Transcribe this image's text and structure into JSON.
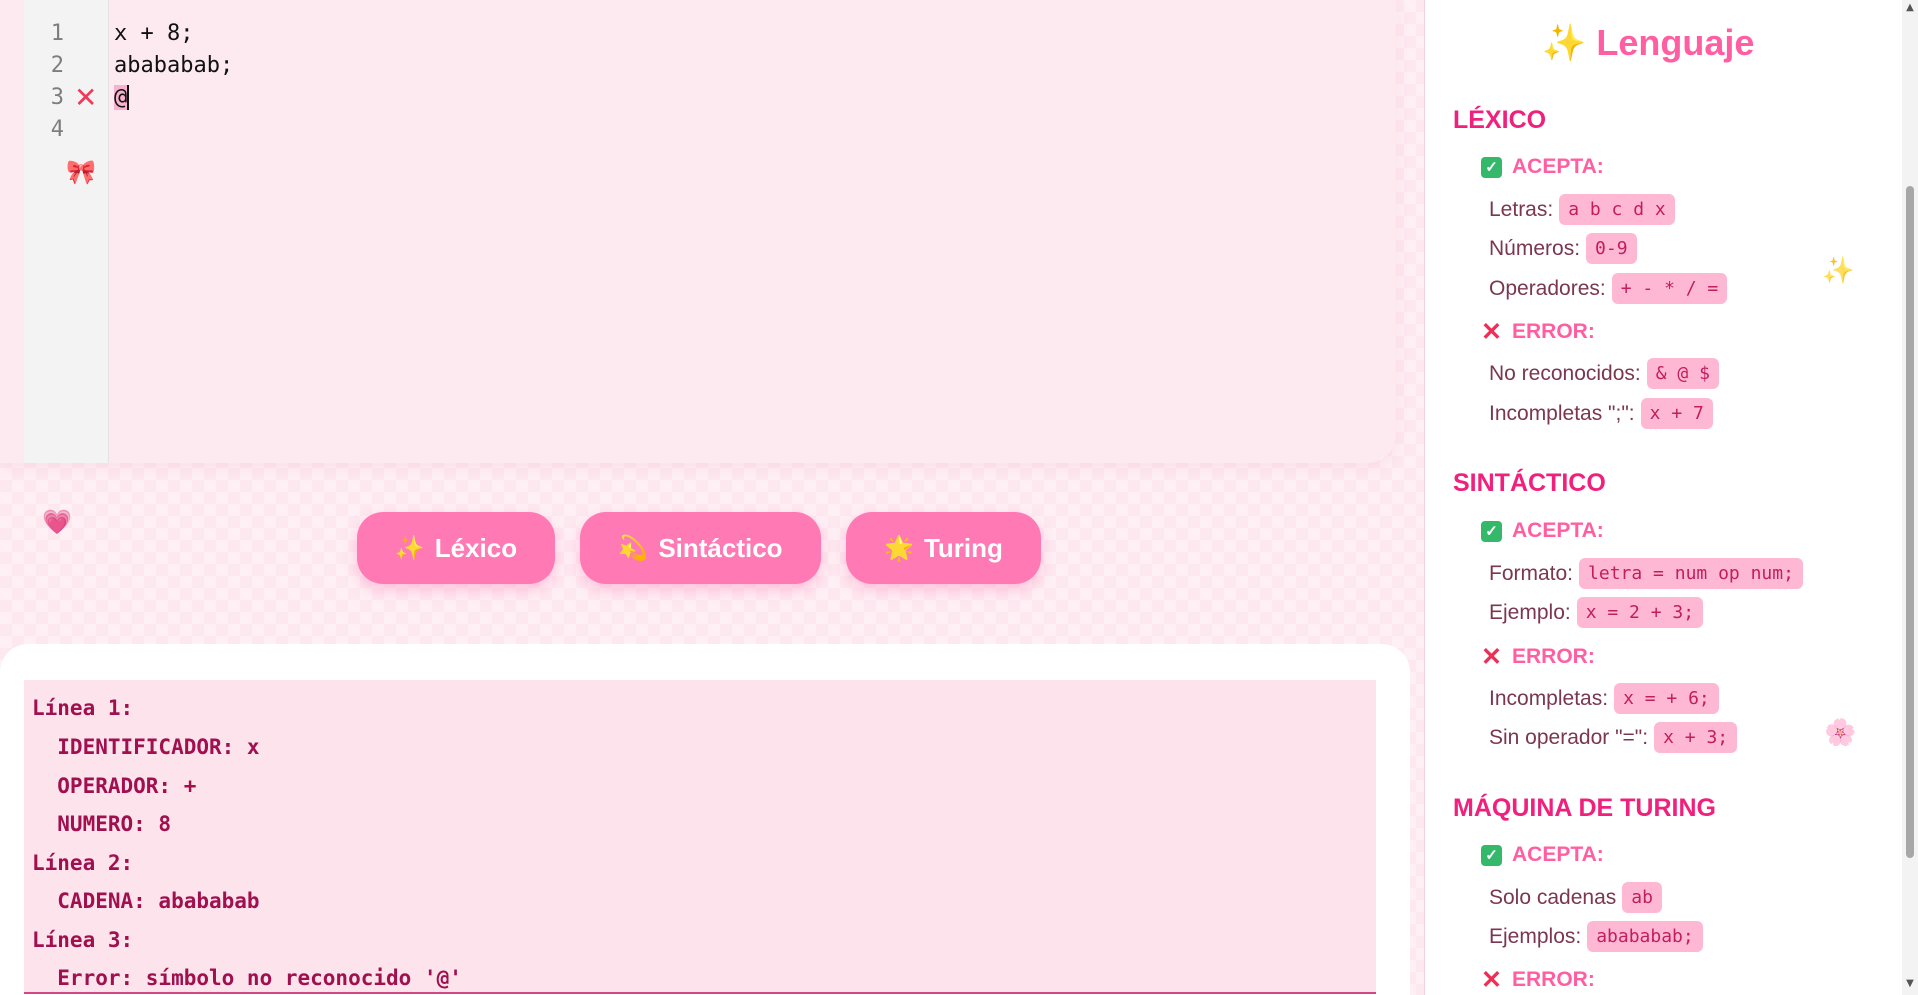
{
  "editor": {
    "line_numbers": [
      "1",
      "2",
      "3",
      "4"
    ],
    "lines": [
      "x + 8;",
      "abababab;",
      "@",
      ""
    ],
    "error_line": "3",
    "error_icon": "cross-mark-icon",
    "bow_icon": "ribbon-icon"
  },
  "buttons": {
    "lexico": {
      "icon": "✨",
      "label": "Léxico"
    },
    "sintactico": {
      "icon": "💫",
      "label": "Sintáctico"
    },
    "turing": {
      "icon": "🌟",
      "label": "Turing"
    }
  },
  "output": {
    "lines": [
      "Línea 1:",
      "  IDENTIFICADOR: x",
      "  OPERADOR: +",
      "  NUMERO: 8",
      "Línea 2:",
      "  CADENA: abababab",
      "Línea 3:",
      "  Error: símbolo no reconocido '@'"
    ]
  },
  "sidebar": {
    "title_icon": "✨",
    "title": "Lenguaje",
    "accepts_label": "ACEPTA:",
    "error_label": "ERROR:",
    "lexico": {
      "title": "LÉXICO",
      "accepts": [
        {
          "label": "Letras:",
          "value": "a b c d x"
        },
        {
          "label": "Números:",
          "value": "0-9"
        },
        {
          "label": "Operadores:",
          "value": "+ - * / ="
        }
      ],
      "errors": [
        {
          "label": "No reconocidos:",
          "value": "& @ $"
        },
        {
          "label": "Incompletas \";\":",
          "value": "x + 7"
        }
      ]
    },
    "sintactico": {
      "title": "SINTÁCTICO",
      "accepts": [
        {
          "label": "Formato:",
          "value": "letra = num op num;"
        },
        {
          "label": "Ejemplo:",
          "value": "x = 2 + 3;"
        }
      ],
      "errors": [
        {
          "label": "Incompletas:",
          "value": "x = + 6;"
        },
        {
          "label": "Sin operador \"=\":",
          "value": "x + 3;"
        }
      ]
    },
    "turing": {
      "title": "MÁQUINA DE TURING",
      "accepts": [
        {
          "label": "Solo cadenas",
          "value": "ab"
        },
        {
          "label": "Ejemplos:",
          "value": "abababab;"
        }
      ]
    }
  },
  "colors": {
    "accent": "#ff79b5",
    "section_title": "#f0217d",
    "pill_bg": "#ffb8d3",
    "output_text": "#a0104f"
  }
}
